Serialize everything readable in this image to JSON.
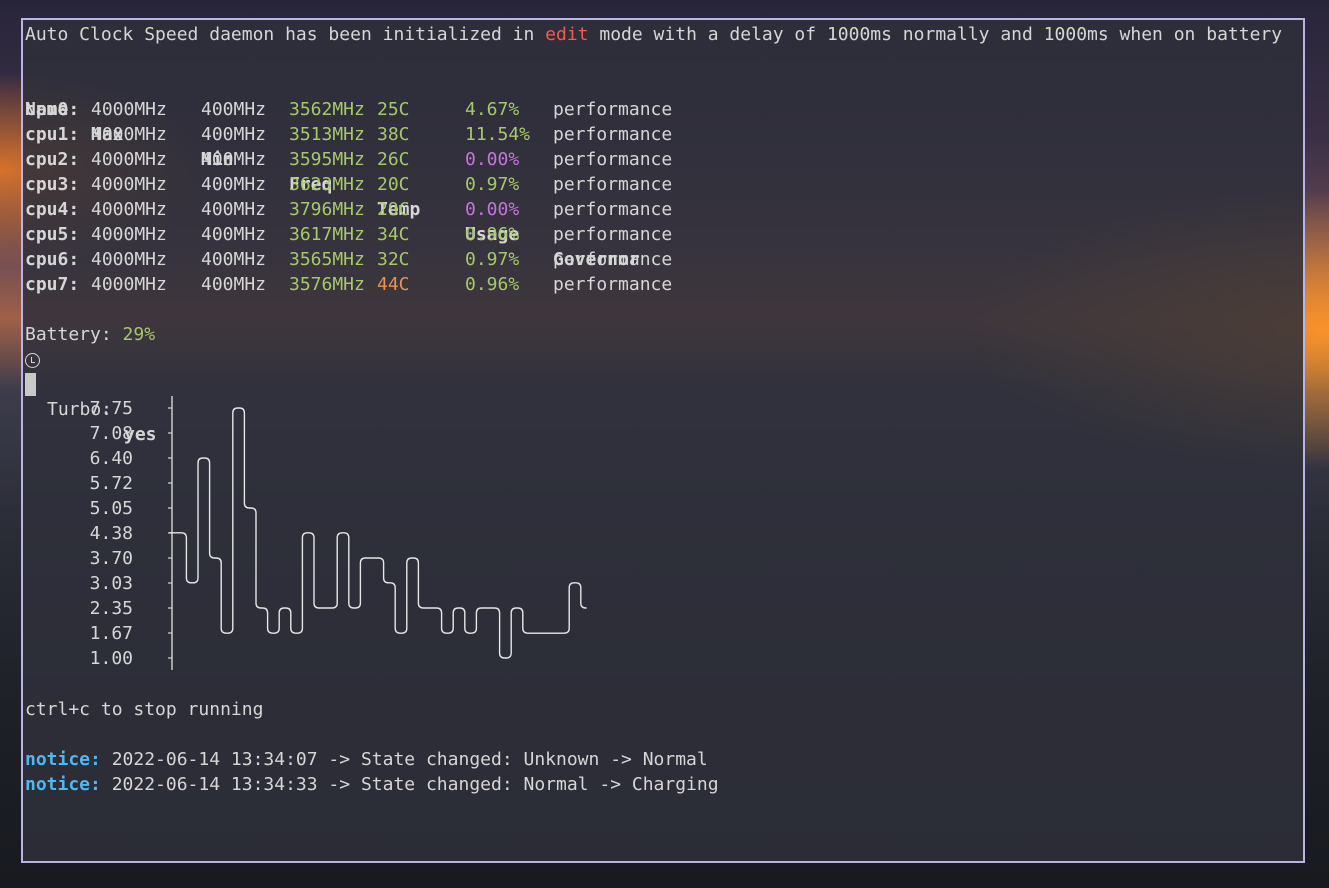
{
  "colors": {
    "border": "#b9b3e6",
    "text": "#d6d6d6",
    "green": "#a6c86a",
    "orange": "#e8924a",
    "purple": "#c574dd",
    "red": "#f05a58",
    "notice": "#4fb8f0"
  },
  "header": {
    "prefix": "Auto Clock Speed daemon has been initialized in ",
    "mode": "edit",
    "suffix": " mode with a delay of 1000ms normally and 1000ms when on battery"
  },
  "table": {
    "columns": [
      "Name",
      "Max",
      "Min",
      "Freq",
      "Temp",
      "Usage",
      "Governor"
    ],
    "rows": [
      {
        "name": "cpu0:",
        "max": "4000MHz",
        "min": "400MHz",
        "freq": "3562MHz",
        "temp": "25C",
        "temp_color": "green",
        "usage": "4.67%",
        "usage_color": "green",
        "governor": "performance"
      },
      {
        "name": "cpu1:",
        "max": "4000MHz",
        "min": "400MHz",
        "freq": "3513MHz",
        "temp": "38C",
        "temp_color": "green",
        "usage": "11.54%",
        "usage_color": "green",
        "governor": "performance"
      },
      {
        "name": "cpu2:",
        "max": "4000MHz",
        "min": "400MHz",
        "freq": "3595MHz",
        "temp": "26C",
        "temp_color": "green",
        "usage": "0.00%",
        "usage_color": "purple",
        "governor": "performance"
      },
      {
        "name": "cpu3:",
        "max": "4000MHz",
        "min": "400MHz",
        "freq": "3623MHz",
        "temp": "20C",
        "temp_color": "green",
        "usage": "0.97%",
        "usage_color": "green",
        "governor": "performance"
      },
      {
        "name": "cpu4:",
        "max": "4000MHz",
        "min": "400MHz",
        "freq": "3796MHz",
        "temp": "29C",
        "temp_color": "green",
        "usage": "0.00%",
        "usage_color": "purple",
        "governor": "performance"
      },
      {
        "name": "cpu5:",
        "max": "4000MHz",
        "min": "400MHz",
        "freq": "3617MHz",
        "temp": "34C",
        "temp_color": "green",
        "usage": "0.96%",
        "usage_color": "green",
        "governor": "performance"
      },
      {
        "name": "cpu6:",
        "max": "4000MHz",
        "min": "400MHz",
        "freq": "3565MHz",
        "temp": "32C",
        "temp_color": "green",
        "usage": "0.97%",
        "usage_color": "green",
        "governor": "performance"
      },
      {
        "name": "cpu7:",
        "max": "4000MHz",
        "min": "400MHz",
        "freq": "3576MHz",
        "temp": "44C",
        "temp_color": "orange",
        "usage": "0.96%",
        "usage_color": "green",
        "governor": "performance"
      }
    ]
  },
  "battery": {
    "label": "Battery: ",
    "value": "29%"
  },
  "turbo": {
    "icon": "turbo-gauge-icon",
    "label": "Turbo: ",
    "value": "yes"
  },
  "chart_data": {
    "type": "line",
    "title": "",
    "xlabel": "",
    "ylabel": "",
    "y_ticks": [
      "7.75",
      "7.08",
      "6.40",
      "5.72",
      "5.05",
      "4.38",
      "3.70",
      "3.03",
      "2.35",
      "1.67",
      "1.00"
    ],
    "ylim": [
      1.0,
      7.75
    ],
    "grid": false,
    "values": [
      4.38,
      3.03,
      6.4,
      3.7,
      1.67,
      7.75,
      5.05,
      2.35,
      1.67,
      2.35,
      1.67,
      4.38,
      2.35,
      2.35,
      4.38,
      2.35,
      3.7,
      3.7,
      3.03,
      1.67,
      3.7,
      2.35,
      2.35,
      1.67,
      2.35,
      1.67,
      2.35,
      2.35,
      1.0,
      2.35,
      1.67,
      1.67,
      1.67,
      1.67,
      3.03,
      2.35
    ]
  },
  "footer": {
    "hint": "ctrl+c to stop running",
    "notices": [
      {
        "label": "notice:",
        "text": " 2022-06-14 13:34:07 -> State changed: Unknown -> Normal"
      },
      {
        "label": "notice:",
        "text": " 2022-06-14 13:34:33 -> State changed: Normal -> Charging"
      }
    ]
  }
}
